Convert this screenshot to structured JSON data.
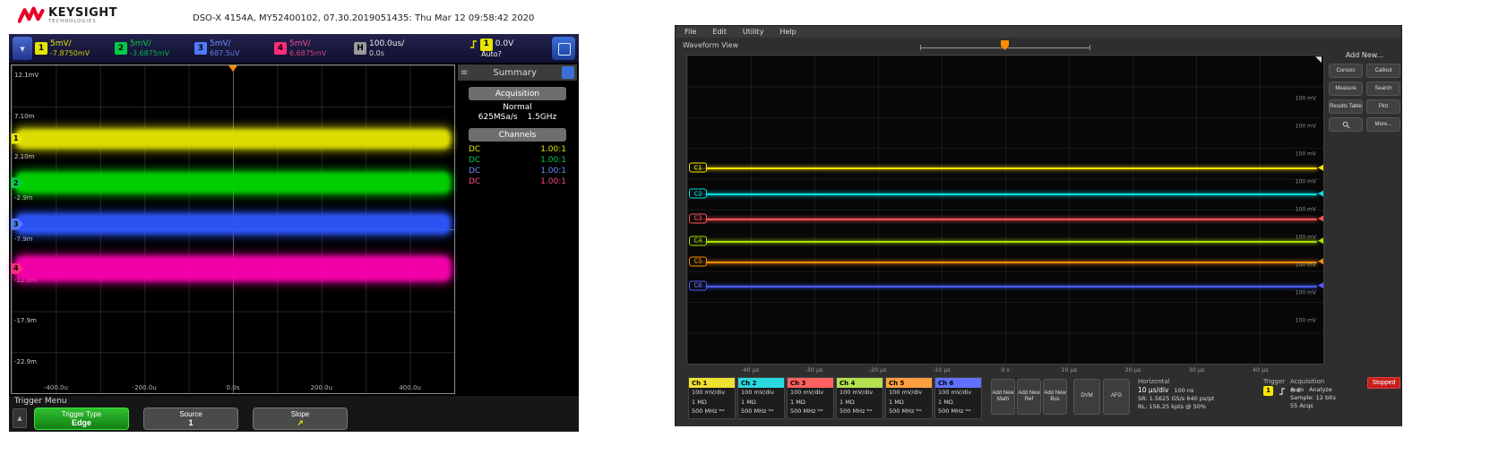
{
  "colors": {
    "keysight_red": "#e90029",
    "ch1_yellow": "#e6e600",
    "ch2_green": "#00cc44",
    "ch3_blue": "#4f7cff",
    "ch4_magenta": "#ff2a7a",
    "tek_c1": "#ffe600",
    "tek_c2": "#00e0e0",
    "tek_c3": "#ff5555",
    "tek_c4": "#a8e000",
    "tek_c5": "#ff8c00",
    "tek_c6": "#4d5cff",
    "stopped_red": "#c81e1e",
    "active_softkey_green": "#1faf1f"
  },
  "icons": {
    "hamburger": "≡",
    "sidebar_toggle": "▾",
    "menu_close": "▲",
    "expand": "◥",
    "slope_up": "↗"
  },
  "left_scope": {
    "brand": {
      "name": "KEYSIGHT",
      "tagline": "TECHNOLOGIES"
    },
    "titlebar": "DSO-X 4154A, MY52400102, 07.30.2019051435: Thu Mar 12 09:58:42 2020",
    "channel_bar": {
      "channels": [
        {
          "num": "1",
          "scale": "5mV/",
          "offset": "-7.8750mV"
        },
        {
          "num": "2",
          "scale": "5mV/",
          "offset": "-3.6875mV"
        },
        {
          "num": "3",
          "scale": "5mV/",
          "offset": "687.5uV"
        },
        {
          "num": "4",
          "scale": "5mV/",
          "offset": "6.6875mV"
        }
      ],
      "horizontal": {
        "label": "H",
        "scale": "100.0us/",
        "delay": "0.0s"
      },
      "trigger": {
        "source": "1",
        "level": "0.0V",
        "mode": "Auto?"
      }
    },
    "graticule": {
      "y_labels": [
        "12.1mV",
        "7.10m",
        "2.10m",
        "-2.9m",
        "-7.9m",
        "-12.9m",
        "-17.9m",
        "-22.9m"
      ],
      "x_labels": [
        "-400.0u",
        "-200.0u",
        "0.0s",
        "200.0u",
        "400.0u"
      ]
    },
    "sidebar": {
      "title": "Summary",
      "acquisition_label": "Acquisition",
      "acquisition_mode": "Normal",
      "sample_rate": "625MSa/s",
      "bandwidth": "1.5GHz",
      "channels_label": "Channels",
      "channel_rows": [
        {
          "coupling": "DC",
          "probe": "1.00:1"
        },
        {
          "coupling": "DC",
          "probe": "1.00:1"
        },
        {
          "coupling": "DC",
          "probe": "1.00:1"
        },
        {
          "coupling": "DC",
          "probe": "1.00:1"
        }
      ]
    },
    "bottom_menu": {
      "title": "Trigger Menu",
      "softkeys": [
        {
          "label": "Trigger Type",
          "value": "Edge"
        },
        {
          "label": "Source",
          "value": "1"
        },
        {
          "label": "Slope",
          "value": "↗"
        }
      ]
    }
  },
  "right_scope": {
    "menubar": [
      "File",
      "Edit",
      "Utility",
      "Help"
    ],
    "view_label": "Waveform View",
    "add_new_panel": {
      "title": "Add New...",
      "buttons": [
        "Cursors",
        "Callout",
        "Measure",
        "Search",
        "Results Table",
        "Plot",
        "More..."
      ]
    },
    "channel_handles": [
      "C1",
      "C2",
      "C3",
      "C4",
      "C5",
      "C6"
    ],
    "time_labels": [
      "-40 μs",
      "-30 μs",
      "-20 μs",
      "-10 μs",
      "0 s",
      "10 μs",
      "20 μs",
      "30 μs",
      "40 μs"
    ],
    "right_axis_label": "100 mV",
    "channel_badges": [
      {
        "name": "Ch 1",
        "scale": "100 mV/div",
        "impedance": "1 MΩ",
        "bandwidth": "500 MHz ᵇʷ"
      },
      {
        "name": "Ch 2",
        "scale": "100 mV/div",
        "impedance": "1 MΩ",
        "bandwidth": "500 MHz ᵇʷ"
      },
      {
        "name": "Ch 3",
        "scale": "100 mV/div",
        "impedance": "1 MΩ",
        "bandwidth": "500 MHz ᵇʷ"
      },
      {
        "name": "Ch 4",
        "scale": "100 mV/div",
        "impedance": "1 MΩ",
        "bandwidth": "500 MHz ᵇʷ"
      },
      {
        "name": "Ch 5",
        "scale": "100 mV/div",
        "impedance": "1 MΩ",
        "bandwidth": "500 MHz ᵇʷ"
      },
      {
        "name": "Ch 6",
        "scale": "100 mV/div",
        "impedance": "1 MΩ",
        "bandwidth": "500 MHz ᵇʷ"
      }
    ],
    "add_buttons": {
      "math": "Add New Math",
      "ref": "Add New Ref",
      "bus": "Add New Bus"
    },
    "dvm_label": "DVM",
    "afg_label": "AFG",
    "horizontal_panel": {
      "title": "Horizontal",
      "scale": "10 μs/div",
      "position": "100 ns",
      "sample_rate": "SR: 1.5625 GS/s 640 ps/pt",
      "record_length": "RL: 156.25 kpts @ 50%"
    },
    "trigger_panel": {
      "title": "Trigger",
      "source": "1",
      "level": "0 V"
    },
    "acquisition_panel": {
      "title": "Acquisition",
      "mode": "Auto",
      "analyze": "Analyze",
      "sample": "Sample: 12 bits",
      "acqs": "55 Acqs"
    },
    "stopped_label": "Stopped"
  }
}
